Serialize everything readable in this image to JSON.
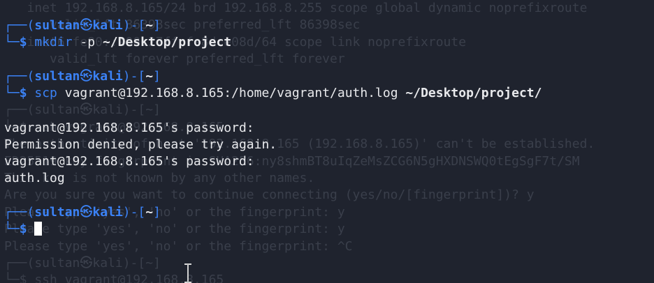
{
  "prompt": {
    "user": "sultan",
    "host": "kali",
    "at_symbol": "㉿",
    "dir": "~"
  },
  "ghost_lines": [
    "   inet 192.168.8.165/24 brd 192.168.8.255 scope global dynamic noprefixroute",
    "      valid_lft 86398sec preferred_lft 86398sec",
    "   inet6 fe80::a00:27ff:fe8d:e08d/64 scope link noprefixroute",
    "      valid_lft forever preferred_lft forever",
    "",
    "",
    "┌──(sultan㉿kali)-[~]",
    "└─$ ssh vagrant@192.168.8.165",
    "The authenticity of host '192.168.8.165 (192.168.8.165)' can't be established.",
    "ED25519 key fingerprint is SHA256:ny8shmBT8uIqZeMsZCG6N5gHXDNSWQ0tEgSgF7t/SM",
    "This key is not known by any other names.",
    "Are you sure you want to continue connecting (yes/no/[fingerprint])? y",
    "Please type 'yes', 'no' or the fingerprint: y",
    "Please type 'yes', 'no' or the fingerprint: y",
    "Please type 'yes', 'no' or the fingerprint: ^C",
    "",
    "┌──(sultan㉿kali)-[~]",
    "└─$ ssh vagrant@192.168.8.165"
  ],
  "session": {
    "cmd1": {
      "name": "mkdir",
      "flag": "-p",
      "path": "~/Desktop/project"
    },
    "cmd2": {
      "name": "scp",
      "src": "vagrant@192.168.8.165:/home/vagrant/auth.log",
      "dest": "~/Desktop/project/"
    },
    "output": [
      "vagrant@192.168.8.165's password:",
      "Permission denied, please try again.",
      "vagrant@192.168.8.165's password:",
      "auth.log"
    ]
  }
}
